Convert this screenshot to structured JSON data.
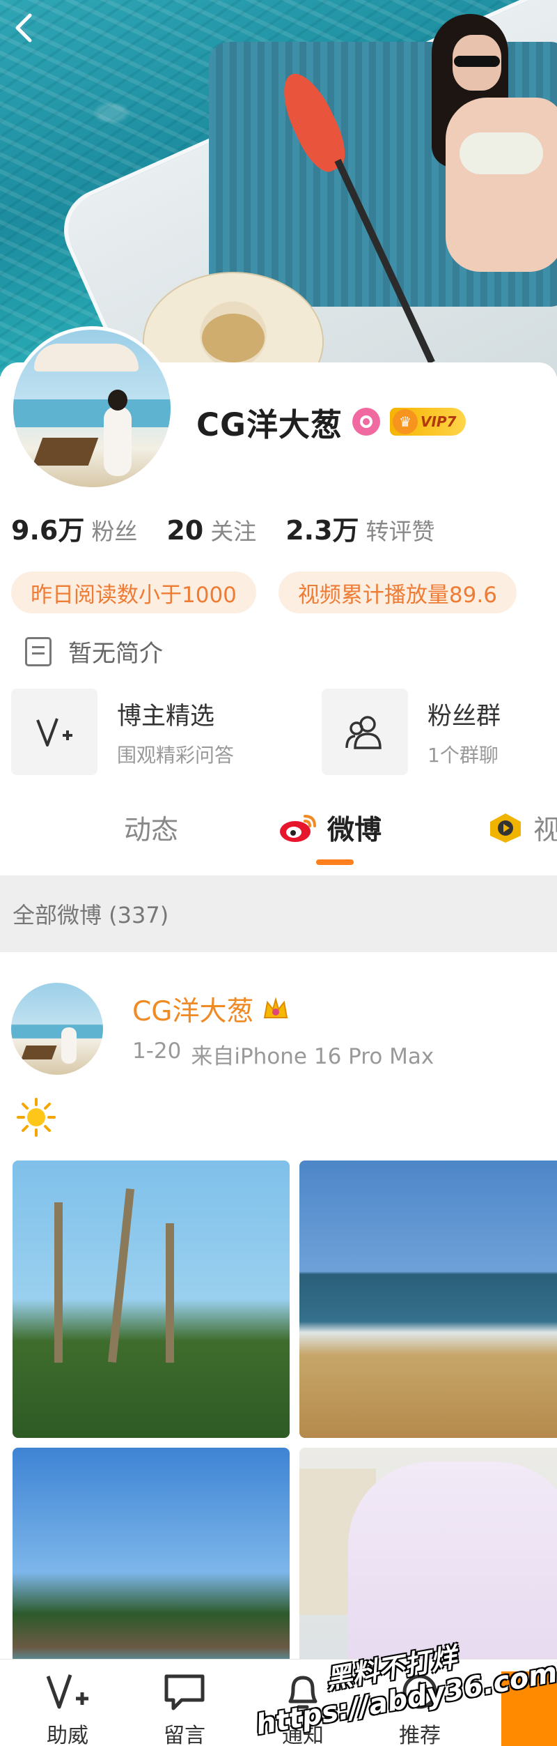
{
  "profile": {
    "name": "CG洋大葱",
    "vip_label": "VIP7",
    "stats": [
      {
        "value": "9.6万",
        "label": "粉丝"
      },
      {
        "value": "20",
        "label": "关注"
      },
      {
        "value": "2.3万",
        "label": "转评赞"
      }
    ],
    "pills": [
      "昨日阅读数小于1000",
      "视频累计播放量89.6"
    ],
    "intro": "暂无简介",
    "features": [
      {
        "title": "博主精选",
        "subtitle": "围观精彩问答",
        "icon": "v-plus-icon"
      },
      {
        "title": "粉丝群",
        "subtitle": "1个群聊",
        "icon": "group-icon"
      }
    ]
  },
  "tabs": [
    {
      "label": "动态",
      "active": false
    },
    {
      "label": "微博",
      "active": true
    },
    {
      "label": "视",
      "active": false
    }
  ],
  "section": {
    "label": "全部微博 (337)"
  },
  "post": {
    "author": "CG洋大葱",
    "date": "1-20",
    "source": "来自iPhone 16 Pro Max",
    "emoji": "sun-icon"
  },
  "bottom_bar": [
    {
      "label": "助威",
      "icon": "v-plus-icon"
    },
    {
      "label": "留言",
      "icon": "message-icon"
    },
    {
      "label": "通知",
      "icon": "bell-icon"
    },
    {
      "label": "推荐",
      "icon": "recommend-icon"
    }
  ],
  "watermark": {
    "line1": "黑料不打烊",
    "line2": "https://abdy36.com"
  },
  "colors": {
    "accent": "#ff7f1c",
    "name_orange": "#f08a24",
    "pill_bg": "#fdeee2",
    "vip_gold": "#f6b400"
  }
}
